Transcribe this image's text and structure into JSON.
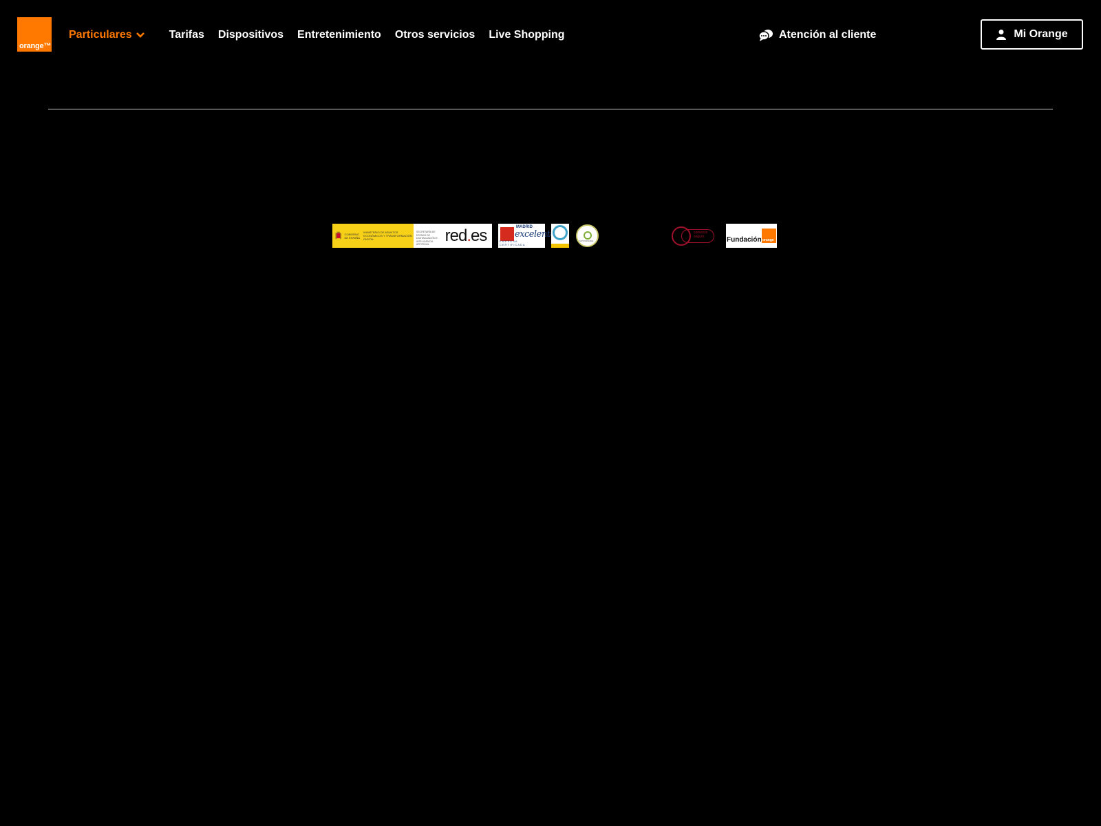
{
  "brand": {
    "logo_text": "orange™",
    "accent_color": "#ff7900"
  },
  "nav": {
    "primary": {
      "label": "Particulares",
      "icon": "chevron-down-icon"
    },
    "items": [
      {
        "label": "Tarifas"
      },
      {
        "label": "Dispositivos"
      },
      {
        "label": "Entretenimiento"
      },
      {
        "label": "Otros servicios"
      },
      {
        "label": "Live Shopping"
      }
    ]
  },
  "support": {
    "label": "Atención al cliente",
    "icon": "chat-bubbles-icon"
  },
  "account": {
    "label": "Mi Orange",
    "icon": "user-icon"
  },
  "footer_badges": {
    "government": {
      "label_1": "GOBIERNO DE ESPAÑA",
      "label_2": "MINISTERIO DE ASUNTOS ECONÓMICOS Y TRANSFORMACIÓN DIGITAL",
      "label_3": "SECRETARÍA DE ESTADO DE DIGITALIZACIÓN E INTELIGENCIA ARTIFICIAL",
      "reds_prefix": "red",
      "reds_dot": ".",
      "reds_suffix": "es"
    },
    "madrid": {
      "label_top": "MADRID",
      "label_main": "excelente",
      "label_bottom": "EMPRESA CERTIFICADA"
    },
    "seal": {
      "label": "SUSTAINABLE"
    },
    "secure": {
      "label": "comercio seguro"
    },
    "fundacion": {
      "label": "Fundación",
      "logo_text": "orange"
    }
  }
}
